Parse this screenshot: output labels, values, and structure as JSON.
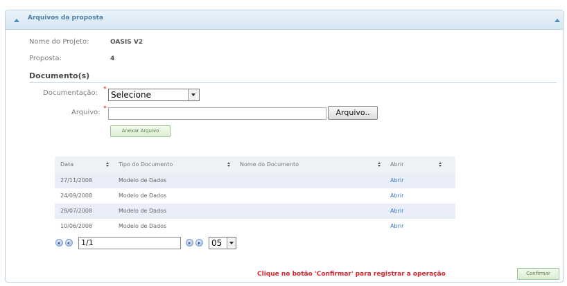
{
  "panel": {
    "title": "Arquivos da proposta"
  },
  "project": {
    "name_label": "Nome do Projeto:",
    "name_value": "OASIS V2",
    "proposal_label": "Proposta:",
    "proposal_value": "4"
  },
  "documents": {
    "section_title": "Documento(s)",
    "documentation_label": "Documentação:",
    "documentation_selected": "Selecione",
    "file_label": "Arquivo:",
    "file_value": "",
    "file_button": "Arquivo..",
    "attach_button": "Anexar Arquivo",
    "required_mark": "*"
  },
  "table": {
    "columns": [
      "Data",
      "Tipo do Documento",
      "Nome do Documento",
      "Abrir"
    ],
    "rows": [
      {
        "date": "27/11/2008",
        "type": "Modelo de Dados",
        "name": "",
        "open": "Abrir"
      },
      {
        "date": "24/09/2008",
        "type": "Modelo de Dados",
        "name": "",
        "open": "Abrir"
      },
      {
        "date": "28/07/2008",
        "type": "Modelo de Dados",
        "name": "",
        "open": "Abrir"
      },
      {
        "date": "10/06/2008",
        "type": "Modelo de Dados",
        "name": "",
        "open": "Abrir"
      }
    ]
  },
  "pager": {
    "page_value": "1/1",
    "page_size": "05"
  },
  "footer": {
    "message": "Clique no botão 'Confirmar' para registrar a operação",
    "confirm_button": "Confirmar"
  },
  "colors": {
    "accent": "#4a7fa8",
    "link": "#3b78c8",
    "warning": "#d8262f",
    "row_alt": "#e9eef8"
  }
}
